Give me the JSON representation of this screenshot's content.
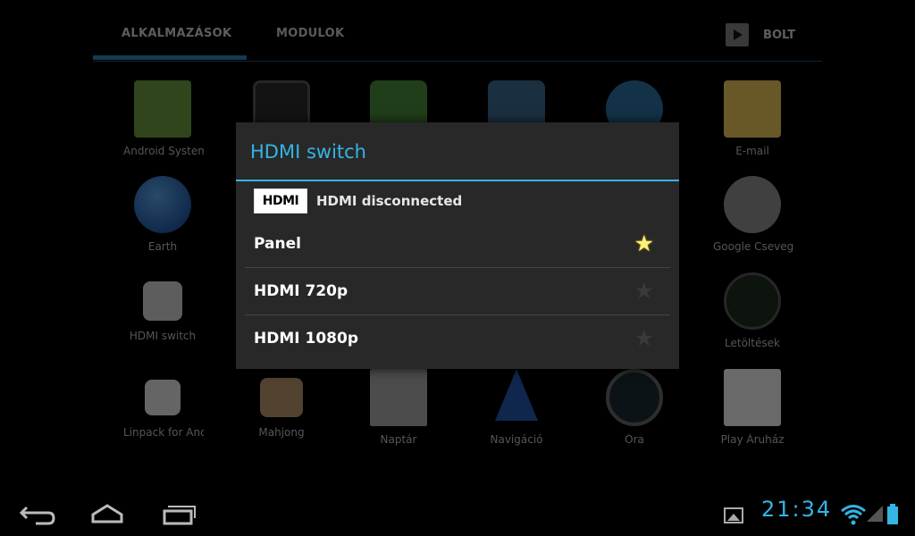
{
  "tabs": {
    "apps": "ALKALMAZÁSOK",
    "widgets": "MODULOK",
    "store": "BOLT"
  },
  "apps": [
    {
      "label": "Android System",
      "icon": "android-system-info-icon"
    },
    {
      "label": "",
      "icon": "antutu-icon"
    },
    {
      "label": "",
      "icon": "android-gift-icon"
    },
    {
      "label": "",
      "icon": "settings-icon"
    },
    {
      "label": "",
      "icon": "globe-icon"
    },
    {
      "label": "E-mail",
      "icon": "email-icon"
    },
    {
      "label": "Earth",
      "icon": "earth-icon"
    },
    {
      "label": "Google Csevegő",
      "icon": "talk-icon"
    },
    {
      "label": "HDMI switch",
      "icon": "hdmi-icon"
    },
    {
      "label": "Letöltések",
      "icon": "download-icon"
    },
    {
      "label": "Linpack for Android",
      "icon": "linpack-icon"
    },
    {
      "label": "Mahjong",
      "icon": "mahjong-icon"
    },
    {
      "label": "Naptár",
      "icon": "calendar-icon"
    },
    {
      "label": "Navigáció",
      "icon": "navigation-icon"
    },
    {
      "label": "Óra",
      "icon": "clock-icon"
    },
    {
      "label": "Play Áruház",
      "icon": "play-store-icon"
    }
  ],
  "dialog": {
    "title": "HDMI switch",
    "logo_text": "HDMI",
    "status": "HDMI disconnected",
    "options": [
      {
        "label": "Panel",
        "selected": true
      },
      {
        "label": "HDMI 720p",
        "selected": false
      },
      {
        "label": "HDMI 1080p",
        "selected": false
      }
    ]
  },
  "statusbar": {
    "time": "21:34"
  },
  "colors": {
    "accent": "#33b5e5",
    "star_on": "#fdef7c",
    "dialog_bg": "#282828"
  }
}
